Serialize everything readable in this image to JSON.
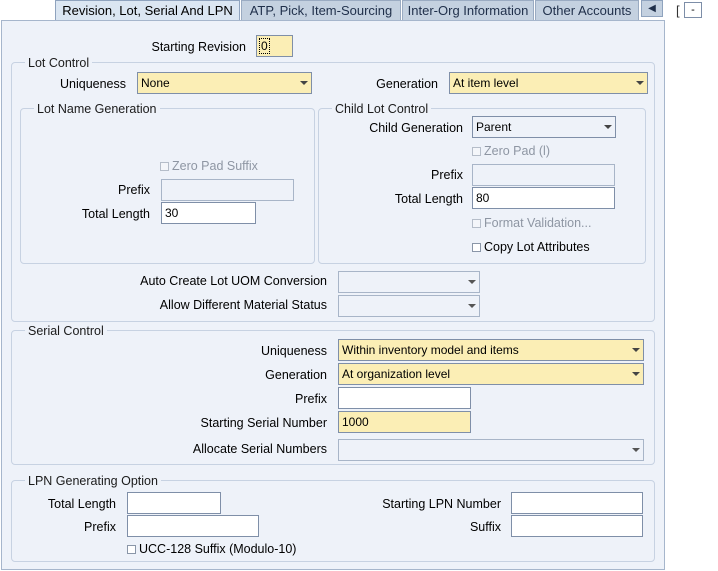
{
  "tabs": [
    {
      "label": "Revision, Lot, Serial And LPN",
      "active": true
    },
    {
      "label": "ATP, Pick, Item-Sourcing",
      "active": false
    },
    {
      "label": "Inter-Org Information",
      "active": false
    },
    {
      "label": "Other Accounts",
      "active": false
    }
  ],
  "window_bracket": "[",
  "window_box_text": "-",
  "revision": {
    "label": "Starting Revision",
    "value": "0"
  },
  "lot_control": {
    "title": "Lot Control",
    "uniqueness": {
      "label": "Uniqueness",
      "value": "None"
    },
    "generation": {
      "label": "Generation",
      "value": "At item level"
    },
    "lot_name_generation": {
      "title": "Lot Name Generation",
      "zero_pad_suffix": "Zero Pad Suffix",
      "prefix": {
        "label": "Prefix",
        "value": ""
      },
      "total_length": {
        "label": "Total Length",
        "value": "30"
      }
    },
    "child_lot_control": {
      "title": "Child Lot Control",
      "child_generation": {
        "label": "Child Generation",
        "value": "Parent"
      },
      "zero_pad": "Zero Pad (l)",
      "prefix": {
        "label": "Prefix",
        "value": ""
      },
      "total_length": {
        "label": "Total Length",
        "value": "80"
      },
      "format_validation": "Format Validation...",
      "copy_lot_attributes": "Copy Lot Attributes"
    },
    "auto_create_uom": {
      "label": "Auto Create Lot UOM Conversion",
      "value": ""
    },
    "allow_diff_status": {
      "label": "Allow Different Material Status",
      "value": ""
    }
  },
  "serial_control": {
    "title": "Serial Control",
    "uniqueness": {
      "label": "Uniqueness",
      "value": "Within inventory model and items"
    },
    "generation": {
      "label": "Generation",
      "value": "At organization level"
    },
    "prefix": {
      "label": "Prefix",
      "value": ""
    },
    "starting_number": {
      "label": "Starting Serial Number",
      "value": "1000"
    },
    "allocate": {
      "label": "Allocate Serial Numbers",
      "value": ""
    }
  },
  "lpn": {
    "title": "LPN Generating Option",
    "total_length": {
      "label": "Total Length",
      "value": ""
    },
    "prefix": {
      "label": "Prefix",
      "value": ""
    },
    "starting_number": {
      "label": "Starting LPN Number",
      "value": ""
    },
    "suffix": {
      "label": "Suffix",
      "value": ""
    },
    "ucc": "UCC-128 Suffix (Modulo-10)"
  }
}
